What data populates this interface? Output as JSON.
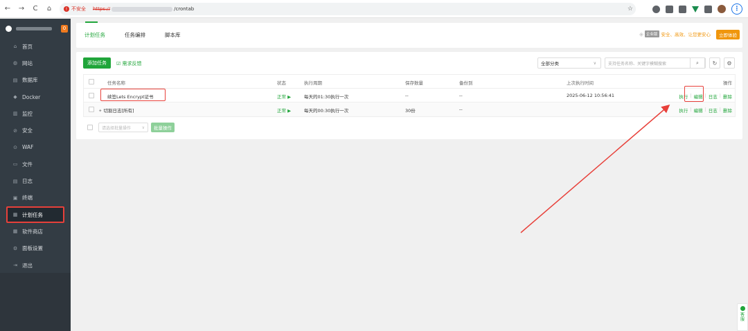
{
  "browser": {
    "back_icon": "←",
    "forward_icon": "→",
    "reload_icon": "C",
    "home_icon": "⌂",
    "insecure_label": "不安全",
    "url_scheme": "https://",
    "url_path": "/crontab",
    "star_icon": "☆"
  },
  "sidebar": {
    "badge": "0",
    "items": [
      {
        "icon": "⌂",
        "label": "首页"
      },
      {
        "icon": "◍",
        "label": "网站"
      },
      {
        "icon": "▤",
        "label": "数据库"
      },
      {
        "icon": "◆",
        "label": "Docker"
      },
      {
        "icon": "▥",
        "label": "监控"
      },
      {
        "icon": "⊘",
        "label": "安全"
      },
      {
        "icon": "⊙",
        "label": "WAF"
      },
      {
        "icon": "▭",
        "label": "文件"
      },
      {
        "icon": "▤",
        "label": "日志"
      },
      {
        "icon": "▣",
        "label": "终端"
      },
      {
        "icon": "▦",
        "label": "计划任务"
      },
      {
        "icon": "▦",
        "label": "软件商店"
      },
      {
        "icon": "⚙",
        "label": "面板设置"
      },
      {
        "icon": "⇥",
        "label": "退出"
      }
    ]
  },
  "tabs": [
    "计划任务",
    "任务编排",
    "脚本库"
  ],
  "promo": {
    "tag": "企业版",
    "text": "安全、高效、让您更安心",
    "button": "立即体验"
  },
  "toolbar": {
    "add_task": "添加任务",
    "feedback": "需求反馈",
    "category": "全部分类",
    "search_placeholder": "支持任务名称、关键字模糊搜索",
    "search_icon": "⌕",
    "refresh_icon": "↻",
    "settings_icon": "⚙"
  },
  "table": {
    "headers": [
      "任务名称",
      "状态",
      "执行周期",
      "保存数量",
      "备份到",
      "上次执行时间",
      "操作"
    ],
    "rows": [
      {
        "name": "续签Lets Encrypt证书",
        "status": "正常 ▶",
        "cycle": "每天的01:30执行一次",
        "keep": "--",
        "backup": "--",
        "last_run": "2025-06-12 10:56:41"
      },
      {
        "name": "切割日志[所有]",
        "status": "正常 ▶",
        "cycle": "每天的00:30执行一次",
        "keep": "30份",
        "backup": "--",
        "last_run": ""
      }
    ],
    "ops": [
      "执行",
      "编辑",
      "日志",
      "删除"
    ]
  },
  "batch": {
    "select_placeholder": "请选择批量操作",
    "button": "批量操作"
  },
  "kefu": {
    "label1": "客",
    "label2": "服"
  },
  "colors": {
    "accent": "#20a53a",
    "highlight": "#e8403a",
    "sidebar": "#333c44"
  }
}
